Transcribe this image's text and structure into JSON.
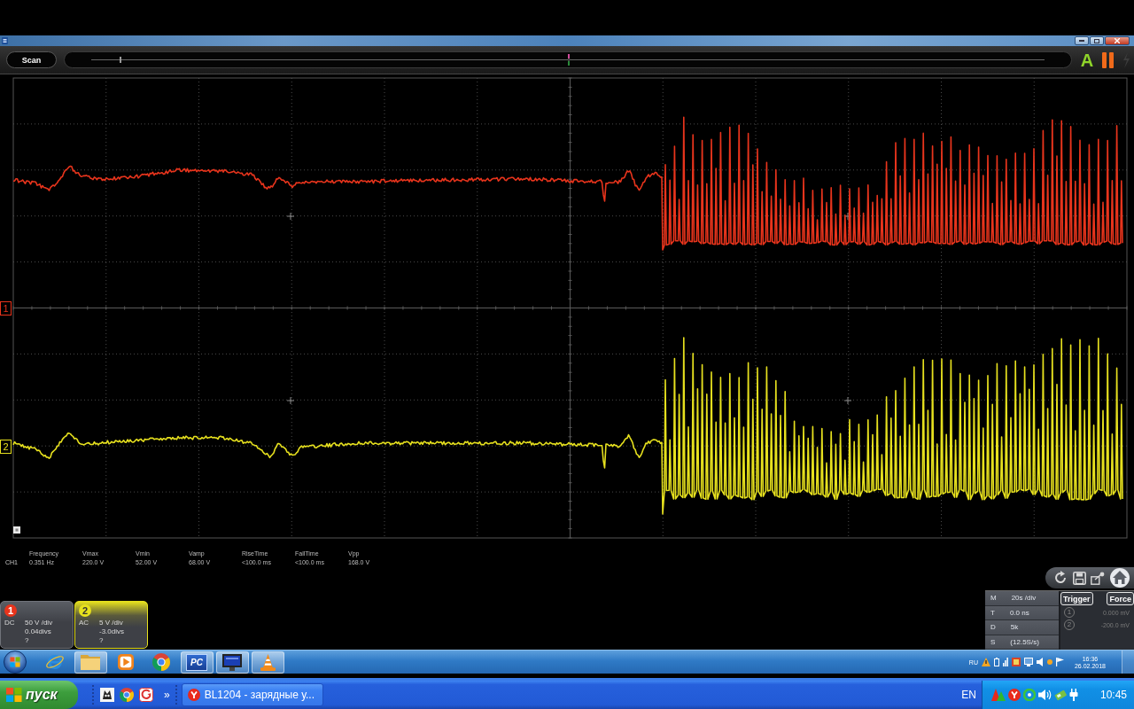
{
  "toolbar": {
    "scan_button": "Scan",
    "timeline": {
      "level": 0.03
    },
    "auto_button": "A"
  },
  "channels": [
    {
      "marker": "1",
      "badge": "1",
      "color": "#e8341c",
      "selected": false,
      "coupling": "DC",
      "scale": "50 V /div",
      "offset": "0.04divs",
      "probe": "?"
    },
    {
      "marker": "2",
      "badge": "2",
      "color": "#e6e01e",
      "selected": true,
      "coupling": "AC",
      "scale": "5 V /div",
      "offset": "-3.0divs",
      "probe": "?"
    }
  ],
  "measurements": {
    "channel": "CH1",
    "items": [
      {
        "label": "Frequency",
        "value": "0.351 Hz"
      },
      {
        "label": "Vmax",
        "value": "220.0 V"
      },
      {
        "label": "Vmin",
        "value": "52.00 V"
      },
      {
        "label": "Vamp",
        "value": "68.00 V"
      },
      {
        "label": "RiseTime",
        "value": "<100.0 ms"
      },
      {
        "label": "FallTime",
        "value": "<100.0 ms"
      },
      {
        "label": "Vpp",
        "value": "168.0 V"
      }
    ]
  },
  "timebase": [
    {
      "key": "M",
      "value": "20s /div"
    },
    {
      "key": "T",
      "value": "0.0 ns"
    },
    {
      "key": "D",
      "value": "5k"
    },
    {
      "key": "S",
      "value": "(12.5S/s)"
    }
  ],
  "trigger": {
    "buttons": [
      "Trigger",
      "Force"
    ],
    "levels": [
      {
        "channel": "1",
        "value": "0.000 mV"
      },
      {
        "channel": "2",
        "value": "-200.0 mV"
      }
    ]
  },
  "inner_taskbar": {
    "apps": [
      {
        "active": false
      },
      {
        "active": true
      },
      {
        "active": false
      },
      {
        "active": false
      },
      {
        "active": true,
        "label": "PC"
      },
      {
        "active": true
      },
      {
        "active": true
      }
    ],
    "language": "RU",
    "time": "16:36",
    "date": "26.02.2018"
  },
  "taskbar": {
    "start_button": "пуск",
    "more_button": "»",
    "tasks": [
      {
        "label": "BL1204 - зарядные у..."
      }
    ],
    "language": "EN",
    "clock": "10:45"
  }
}
